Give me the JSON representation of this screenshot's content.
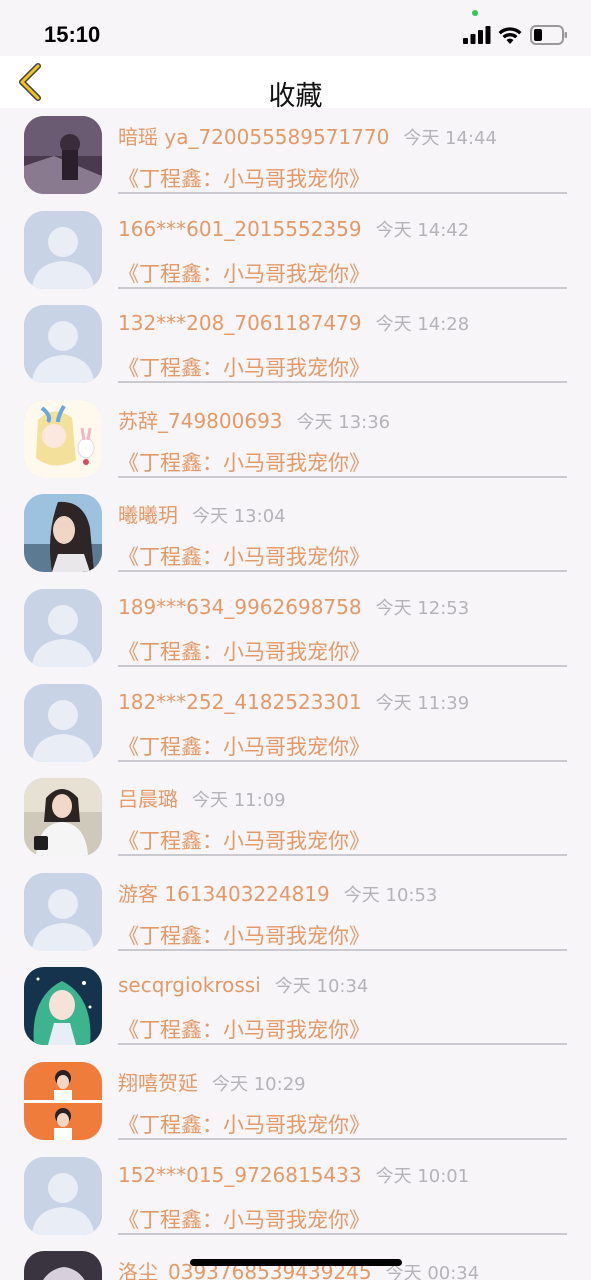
{
  "status_bar": {
    "time": "15:10"
  },
  "nav": {
    "title": "收藏",
    "back_icon": "chevron-left-icon",
    "accent": "#f5c518"
  },
  "colors": {
    "name": "#e49a68",
    "time": "#b4b4b8",
    "background": "#f7f5f8"
  },
  "items": [
    {
      "name": "暗瑶 ya_720055589571770",
      "time": "今天 14:44",
      "subtitle": "《丁程鑫：小马哥我宠你》",
      "avatar": "photo-dark-girl"
    },
    {
      "name": "166***601_2015552359",
      "time": "今天 14:42",
      "subtitle": "《丁程鑫：小马哥我宠你》",
      "avatar": "default-user"
    },
    {
      "name": "132***208_7061187479",
      "time": "今天 14:28",
      "subtitle": "《丁程鑫：小马哥我宠你》",
      "avatar": "default-user"
    },
    {
      "name": "苏辞_749800693",
      "time": "今天 13:36",
      "subtitle": "《丁程鑫：小马哥我宠你》",
      "avatar": "anime-bunny-girl"
    },
    {
      "name": "曦曦玥",
      "time": "今天 13:04",
      "subtitle": "《丁程鑫：小马哥我宠你》",
      "avatar": "photo-girl-sky"
    },
    {
      "name": "189***634_9962698758",
      "time": "今天 12:53",
      "subtitle": "《丁程鑫：小马哥我宠你》",
      "avatar": "default-user"
    },
    {
      "name": "182***252_4182523301",
      "time": "今天 11:39",
      "subtitle": "《丁程鑫：小马哥我宠你》",
      "avatar": "default-user"
    },
    {
      "name": "吕晨璐",
      "time": "今天 11:09",
      "subtitle": "《丁程鑫：小马哥我宠你》",
      "avatar": "photo-girl-camera"
    },
    {
      "name": "游客 1613403224819",
      "time": "今天 10:53",
      "subtitle": "《丁程鑫：小马哥我宠你》",
      "avatar": "default-user"
    },
    {
      "name": "secqrgiokrossi",
      "time": "今天 10:34",
      "subtitle": "《丁程鑫：小马哥我宠你》",
      "avatar": "anime-green-hair"
    },
    {
      "name": "翔嘻贺延",
      "time": "今天 10:29",
      "subtitle": "《丁程鑫：小马哥我宠你》",
      "avatar": "photo-orange-boy"
    },
    {
      "name": "152***015_9726815433",
      "time": "今天 10:01",
      "subtitle": "《丁程鑫：小马哥我宠你》",
      "avatar": "default-user"
    },
    {
      "name": "洛尘_0393768539439245",
      "time": "今天 00:34",
      "subtitle": "",
      "avatar": "anime-dark"
    }
  ]
}
